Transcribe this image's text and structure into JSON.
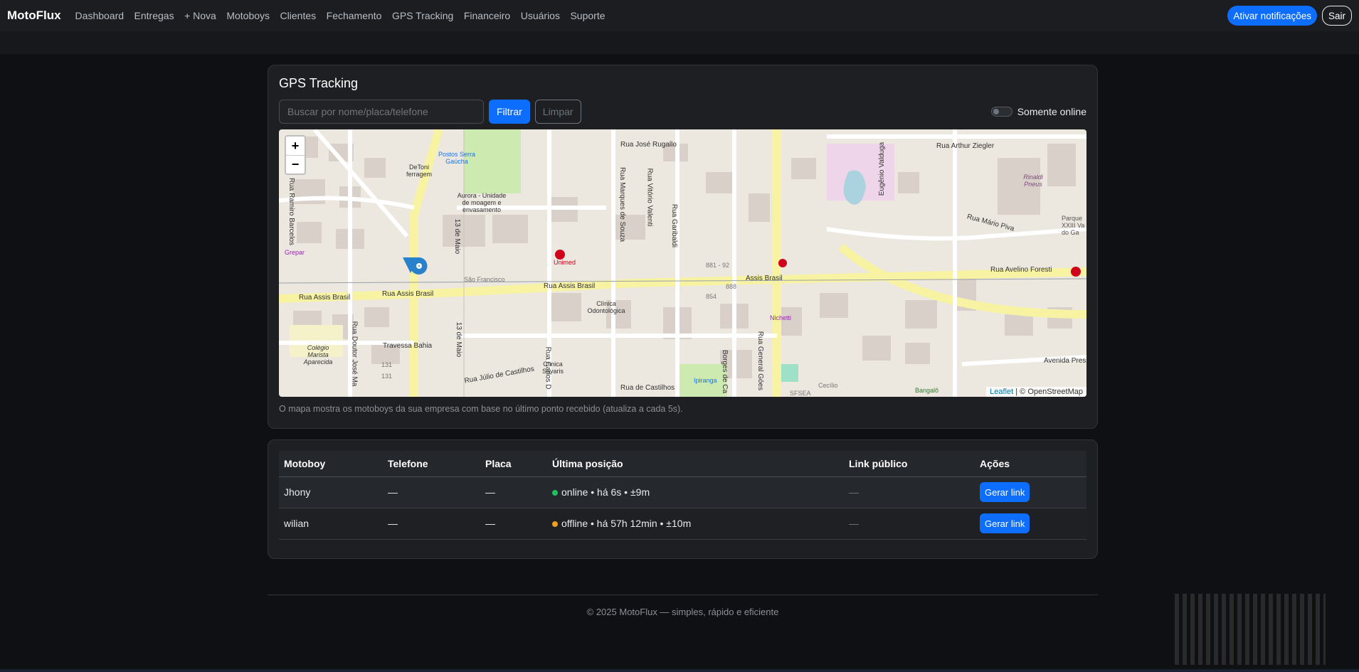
{
  "nav": {
    "brand": "MotoFlux",
    "links": [
      "Dashboard",
      "Entregas",
      "+ Nova",
      "Motoboys",
      "Clientes",
      "Fechamento",
      "GPS Tracking",
      "Financeiro",
      "Usuários",
      "Suporte"
    ],
    "notify_label": "Ativar notificações",
    "logout_label": "Sair"
  },
  "tracking": {
    "title": "GPS Tracking",
    "search_placeholder": "Buscar por nome/placa/telefone",
    "filter_label": "Filtrar",
    "clear_label": "Limpar",
    "toggle_label": "Somente online",
    "toggle_on": false,
    "map_note": "O mapa mostra os motoboys da sua empresa com base no último ponto recebido (atualiza a cada 5s).",
    "zoom_in": "+",
    "zoom_out": "−",
    "attribution_leaflet": "Leaflet",
    "attribution_osm": "| © OpenStreetMap"
  },
  "map_labels": {
    "street_rua_assis_brasil_w": "Rua Assis Brasil",
    "street_rua_assis_brasil_c": "Rua Assis Brasil",
    "street_rua_assis_brasil_e": "Rua Assis Brasil",
    "street_assis_brasil": "Assis Brasil",
    "street_13_maio_a": "13 de Maio",
    "street_13_maio_b": "13 de Maio",
    "street_travessa_bahia": "Travessa Bahia",
    "street_julio_castilhos": "Rua Júlio de Castilhos",
    "street_jose_rugallo": "Rua José Rugallo",
    "street_arthur_ziegler": "Rua Arthur Ziegler",
    "street_avelino_foresti": "Rua Avelino Foresti",
    "street_mario_piva": "Rua Mário Piva",
    "street_avenida_pres": "Avenida Pres",
    "street_eugenio_valduga": "Eugênio Valduga",
    "street_marques_souza": "Rua Marques de Souza",
    "street_vitorio_valenti": "Rua Vitório Valenti",
    "street_garibaldi": "Rua Garibaldi",
    "street_ramiro_barcelos": "Rua Ramiro Barcelos",
    "street_doutor_jose": "Rua Doutor José Ma",
    "street_carlos": "Rua Carlos D",
    "street_general_goes": "Rua General Góes",
    "street_borges": "Borges de Ca",
    "street_castro": "Rua de Castilhos",
    "poi_postos": "Postos Serra Gaúcha",
    "poi_detoni": "DeToni ferragem",
    "poi_aurora": "Aurora - Unidade de moagem e envasamento",
    "poi_unimed": "Unimed",
    "poi_clinica_odonto": "Clínica Odontológica",
    "poi_clinica_savaris": "Clínica Savaris",
    "poi_nichetti": "Nichetti",
    "poi_ipiranga": "Ipiranga",
    "poi_bangalo": "Bangalô",
    "poi_colegio": "Colégio Marista Aparecida",
    "poi_grepar": "Grepar",
    "poi_sao_francisco": "São Francisco",
    "poi_rinaldi": "Rinaldi Pneus",
    "poi_parque": "Parque XXIII Va do Ga",
    "poi_sfsa": "SFSEA",
    "poi_cecilio": "Cecílio",
    "num_888": "888",
    "num_854": "854",
    "num_881": "881 - 92",
    "num_131a": "131",
    "num_131b": "131"
  },
  "table": {
    "headers": [
      "Motoboy",
      "Telefone",
      "Placa",
      "Última posição",
      "Link público",
      "Ações"
    ],
    "rows": [
      {
        "name": "Jhony",
        "phone": "—",
        "plate": "—",
        "status": "online",
        "position": "online • há 6s • ±9m",
        "status_color": "#20c05c",
        "link": "—",
        "action": "Gerar link"
      },
      {
        "name": "wilian",
        "phone": "—",
        "plate": "—",
        "status": "offline",
        "position": "offline • há 57h 12min • ±10m",
        "status_color": "#f0a020",
        "link": "—",
        "action": "Gerar link"
      }
    ]
  },
  "footer": {
    "text": "© 2025 MotoFlux — simples, rápido e eficiente"
  },
  "colors": {
    "accent": "#0d6efd",
    "marker": "#2a81cb"
  }
}
